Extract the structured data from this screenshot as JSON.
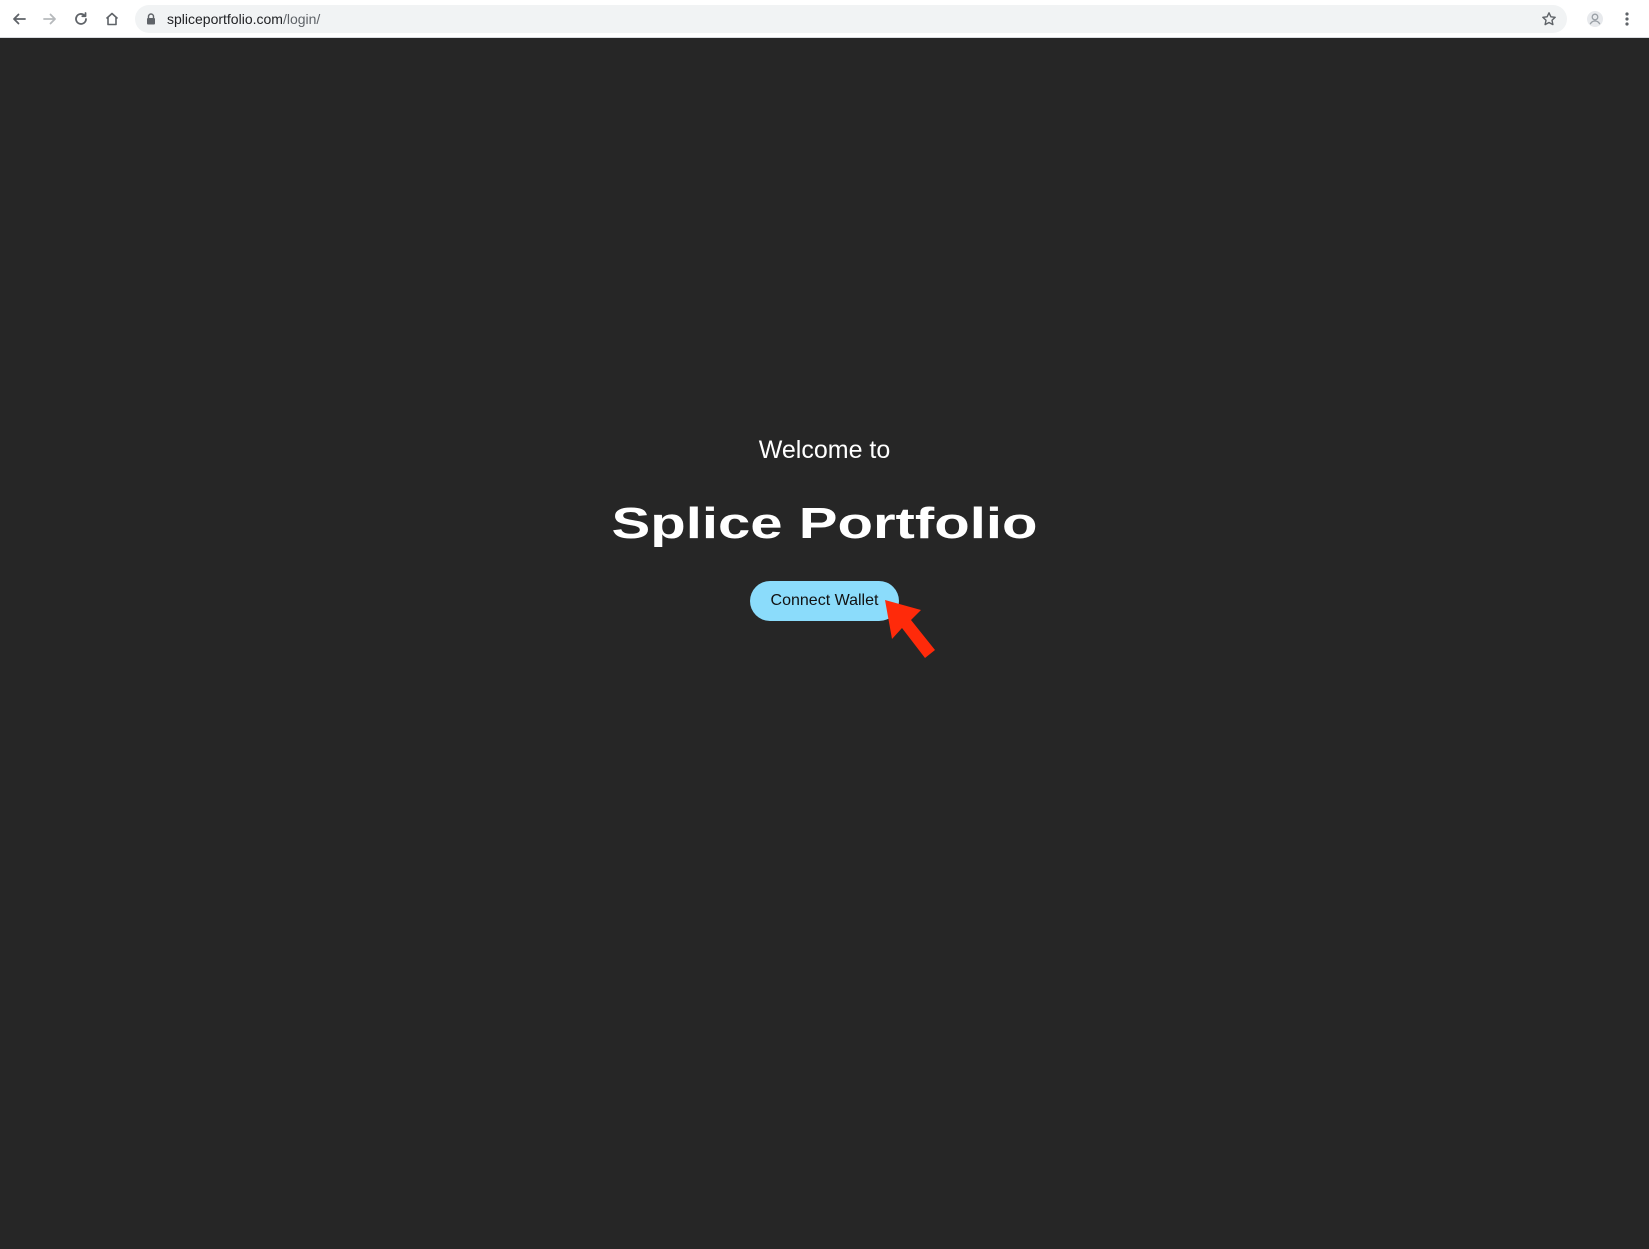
{
  "browser": {
    "url_host": "spliceportfolio.com",
    "url_path": "/login/",
    "icons": {
      "back": "back-arrow-icon",
      "forward": "forward-arrow-icon",
      "reload": "reload-icon",
      "home": "home-icon",
      "lock": "lock-icon",
      "bookmark": "star-icon",
      "profile": "profile-icon",
      "menu": "kebab-menu-icon"
    }
  },
  "login": {
    "welcome_text": "Welcome to",
    "brand_name": "Splice Portfolio",
    "connect_button_label": "Connect Wallet"
  },
  "colors": {
    "page_background": "#262626",
    "button_background": "#8bdcfb",
    "annotation_arrow": "#ff2a0a"
  }
}
